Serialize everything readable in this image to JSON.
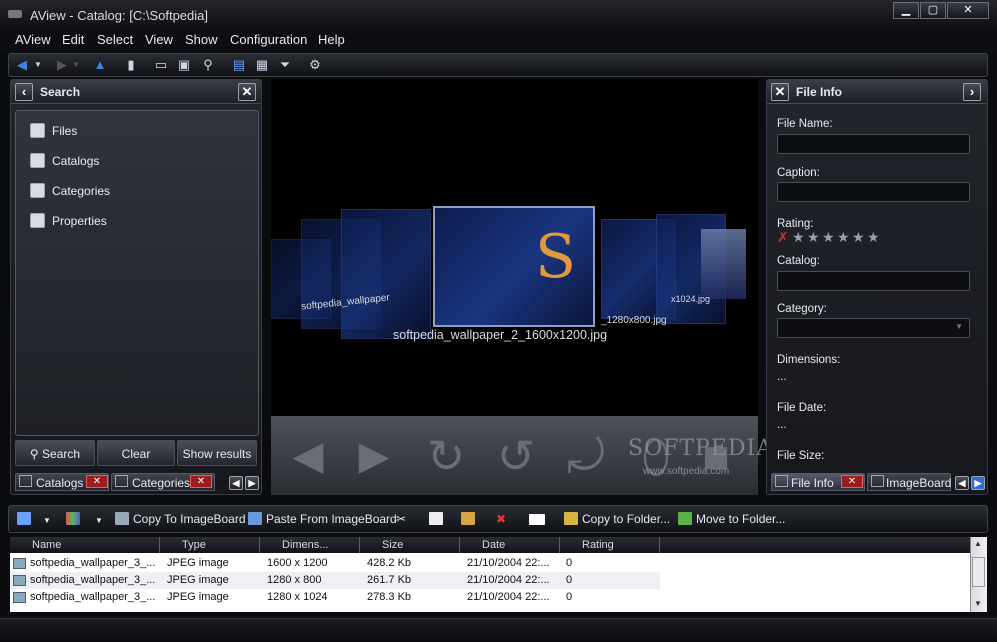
{
  "window": {
    "title": "AView - Catalog: [C:\\Softpedia]",
    "min": "▁",
    "max": "▢",
    "close": "✕"
  },
  "menu": [
    "AView",
    "Edit",
    "Select",
    "View",
    "Show",
    "Configuration",
    "Help"
  ],
  "left_panel": {
    "title": "Search",
    "items": [
      "Files",
      "Catalogs",
      "Categories",
      "Properties"
    ],
    "buttons": {
      "search": "Search",
      "clear": "Clear",
      "show_results": "Show results"
    },
    "tabs": [
      "Catalogs",
      "Categories"
    ]
  },
  "viewer": {
    "selected_caption": "softpedia_wallpaper_2_1600x1200.jpg",
    "left_caption": "softpedia_wallpaper",
    "right_caption": "_1280x800.jpg",
    "far_right_caption": "x1024.jpg",
    "watermark": "SOFTPEDIA",
    "watermark_sub": "www.softpedia.com"
  },
  "right_panel": {
    "title": "File Info",
    "labels": {
      "file_name": "File Name:",
      "caption": "Caption:",
      "rating": "Rating:",
      "catalog": "Catalog:",
      "category": "Category:",
      "dimensions": "Dimensions:",
      "file_date": "File Date:",
      "file_size": "File Size:"
    },
    "dimensions_value": "...",
    "file_date_value": "...",
    "rating_stars": 0,
    "tabs": [
      "File Info",
      "ImageBoard"
    ]
  },
  "bottom_toolbar": {
    "copy_to_imageboard": "Copy To ImageBoard",
    "paste_from_imageboard": "Paste From ImageBoard",
    "copy_to_folder": "Copy to Folder...",
    "move_to_folder": "Move to Folder..."
  },
  "table": {
    "columns": [
      "Name",
      "Type",
      "Dimens...",
      "Size",
      "Date",
      "Rating"
    ],
    "rows": [
      [
        "softpedia_wallpaper_3_...",
        "JPEG image",
        "1600 x 1200",
        "428.2 Kb",
        "21/10/2004 22:...",
        "0"
      ],
      [
        "softpedia_wallpaper_3_...",
        "JPEG image",
        "1280 x 800",
        "261.7 Kb",
        "21/10/2004 22:...",
        "0"
      ],
      [
        "softpedia_wallpaper_3_...",
        "JPEG image",
        "1280 x 1024",
        "278.3 Kb",
        "21/10/2004 22:...",
        "0"
      ]
    ]
  },
  "colors": {
    "accent": "#3c88e0",
    "panel_bg": "#1c1e24",
    "selection_border": "#8fa0c8"
  }
}
